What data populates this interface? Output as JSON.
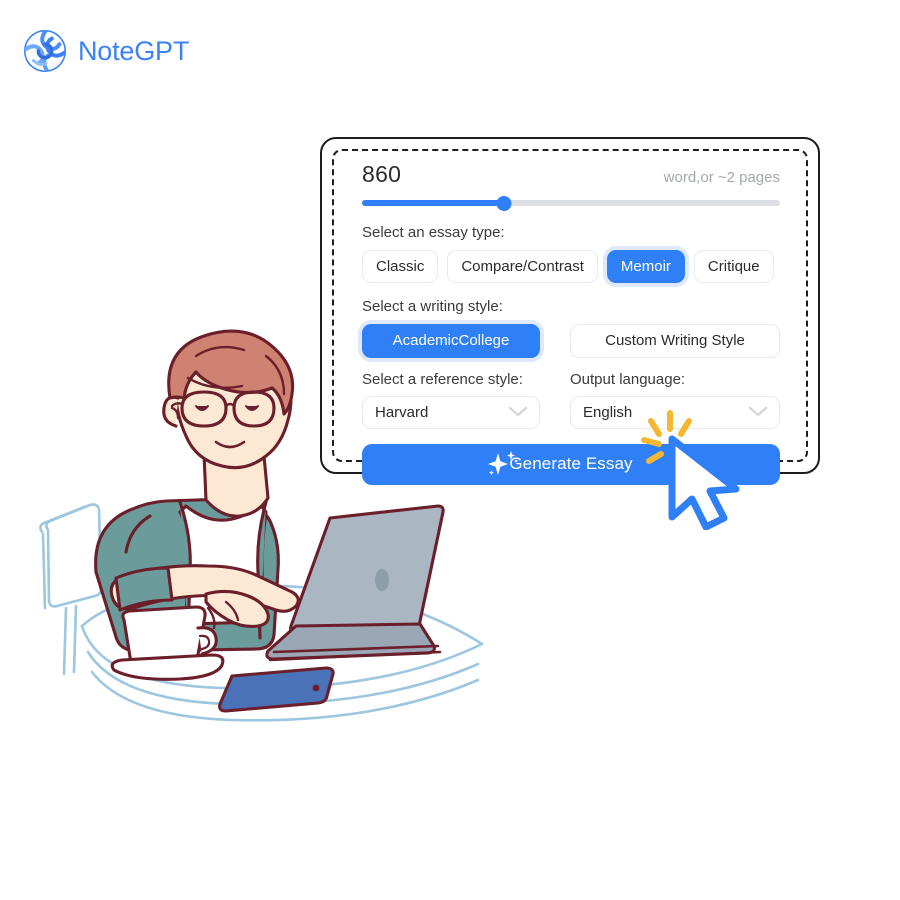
{
  "brand": {
    "name": "NoteGPT",
    "logo_icon": "spiral-logo-icon",
    "color": "#3b82f6"
  },
  "panel": {
    "word_count": {
      "value": "860",
      "hint": "word,or ~2 pages",
      "slider_percent": 34,
      "track_color": "#dcdfe3",
      "fill_color": "#2f80f7"
    },
    "essay_type": {
      "label": "Select an essay type:",
      "options": [
        "Classic",
        "Compare/Contrast",
        "Memoir",
        "Critique"
      ],
      "selected": "Memoir"
    },
    "writing_style": {
      "label": "Select a writing style:",
      "selected": "AcademicCollege",
      "custom_button": "Custom Writing Style"
    },
    "reference_style": {
      "label": "Select a reference style:",
      "value": "Harvard",
      "chevron_icon": "chevron-down-icon"
    },
    "output_language": {
      "label": "Output language:",
      "value": "English",
      "chevron_icon": "chevron-down-icon"
    },
    "generate": {
      "label": "Generate Essay",
      "sparkle_icon": "sparkle-icon",
      "color": "#2f80f7"
    },
    "border_color": "#1d1d1f"
  },
  "cursor": {
    "icon": "mouse-pointer-icon",
    "burst_icon": "click-burst-icon",
    "pointer_outline": "#2f80f7",
    "burst_color": "#f5b731"
  },
  "illustration": {
    "name": "person-typing-on-laptop-illustration",
    "colors": {
      "outline": "#6b1f2a",
      "skin": "#fde8d3",
      "hair": "#cf8272",
      "jacket": "#6b9b9b",
      "shirt": "#ffffff",
      "laptop": "#aab6c2",
      "phone": "#4a72b8",
      "desk_outline": "#9dc6e0"
    }
  }
}
